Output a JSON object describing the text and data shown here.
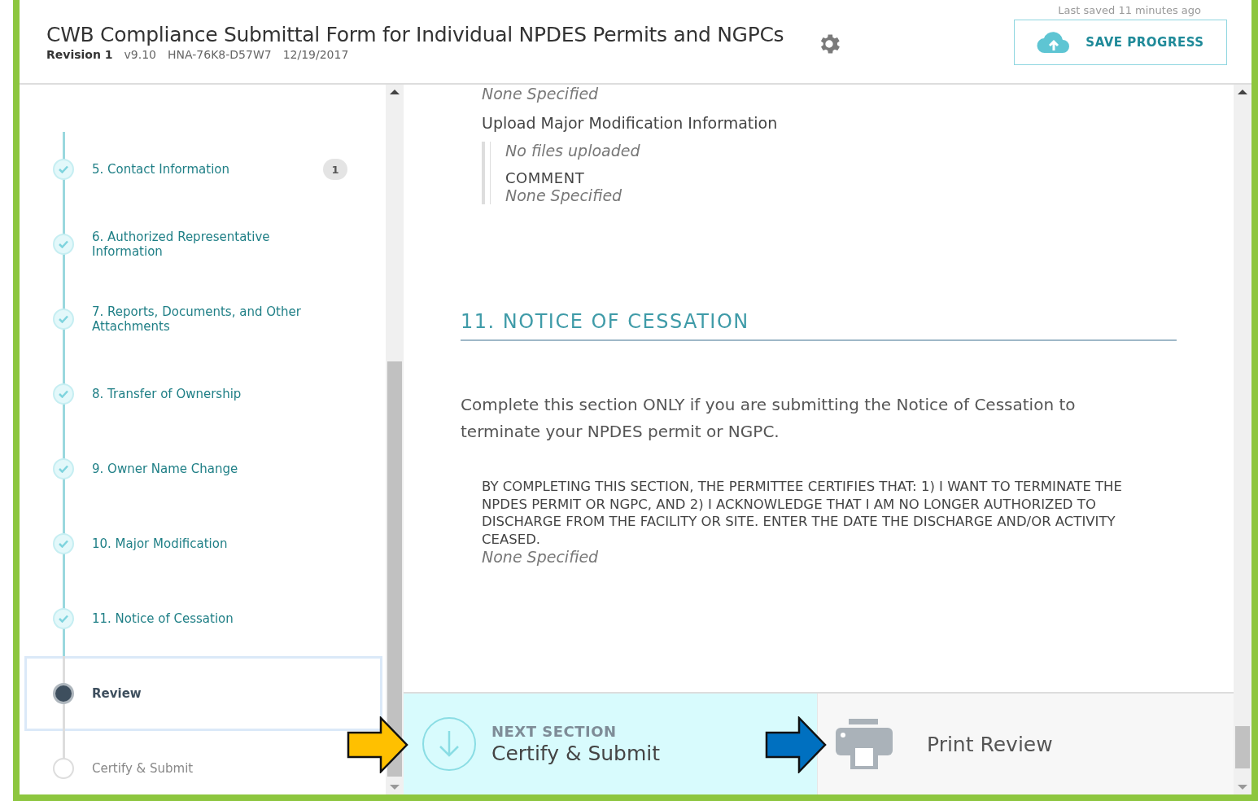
{
  "header": {
    "title": "CWB Compliance Submittal Form for Individual NPDES Permits and NGPCs",
    "revision": "Revision 1",
    "version": "v9.10",
    "code": "HNA-76K8-D57W7",
    "date": "12/19/2017",
    "last_saved": "Last saved 11 minutes ago",
    "save_button": "SAVE PROGRESS"
  },
  "sidebar": {
    "items": [
      {
        "label": "5. Contact Information",
        "kind": "done",
        "selected": false,
        "badge": "1"
      },
      {
        "label": "6. Authorized Representative Information",
        "kind": "done",
        "selected": false
      },
      {
        "label": "7. Reports, Documents, and Other Attachments",
        "kind": "done",
        "selected": false
      },
      {
        "label": "8. Transfer of Ownership",
        "kind": "done",
        "selected": false
      },
      {
        "label": "9. Owner Name Change",
        "kind": "done",
        "selected": false
      },
      {
        "label": "10. Major Modification",
        "kind": "done",
        "selected": false
      },
      {
        "label": "11. Notice of Cessation",
        "kind": "done",
        "selected": false
      },
      {
        "label": "Review",
        "kind": "current",
        "selected": true
      },
      {
        "label": "Certify & Submit",
        "kind": "pending",
        "selected": false
      }
    ]
  },
  "content": {
    "top_value": "None Specified",
    "upload_label": "Upload Major Modification Information",
    "files_value": "No files uploaded",
    "comment_label": "COMMENT",
    "comment_value": "None Specified",
    "section_title": "11. NOTICE OF CESSATION",
    "intro": "Complete this section ONLY if you are submitting the Notice of Cessation to terminate your NPDES permit or NGPC.",
    "certification": "BY COMPLETING THIS SECTION, THE PERMITTEE CERTIFIES THAT: 1) I WANT TO TERMINATE THE NPDES PERMIT OR NGPC, AND 2) I ACKNOWLEDGE THAT I AM NO LONGER AUTHORIZED TO DISCHARGE FROM THE FACILITY OR SITE. ENTER THE DATE THE DISCHARGE AND/OR ACTIVITY CEASED.",
    "certification_value": "None Specified"
  },
  "footer": {
    "next_label": "NEXT SECTION",
    "next_title": "Certify & Submit",
    "print_label": "Print Review"
  }
}
